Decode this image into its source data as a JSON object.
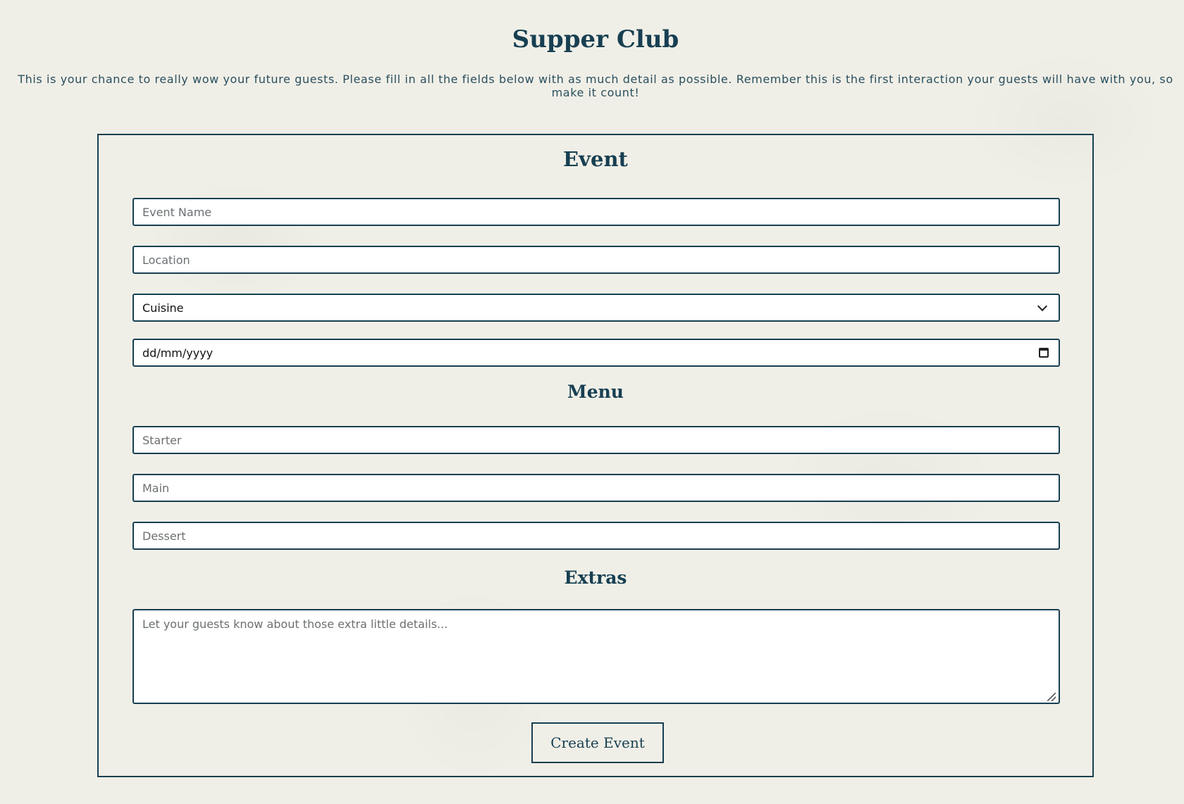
{
  "header": {
    "title": "Supper Club",
    "intro": "This is your chance to really wow your future guests. Please fill in all the fields below with as much detail as possible. Remember this is the first interaction your guests will have with you, so make it count!"
  },
  "form": {
    "event_heading": "Event",
    "event_name_placeholder": "Event Name",
    "location_placeholder": "Location",
    "cuisine_selected": "Cuisine",
    "date_placeholder": "dd/mm/yyyy",
    "menu_heading": "Menu",
    "starter_placeholder": "Starter",
    "main_placeholder": "Main",
    "dessert_placeholder": "Dessert",
    "extras_heading": "Extras",
    "extras_placeholder": "Let your guests know about those extra little details...",
    "submit_label": "Create Event"
  },
  "colors": {
    "accent": "#173f52",
    "background": "#f0efe7",
    "field_background": "#ffffff"
  },
  "icons": {
    "select_arrow": "chevron-down-icon",
    "date_picker": "calendar-icon",
    "textarea_resize": "resize-grip-icon"
  }
}
